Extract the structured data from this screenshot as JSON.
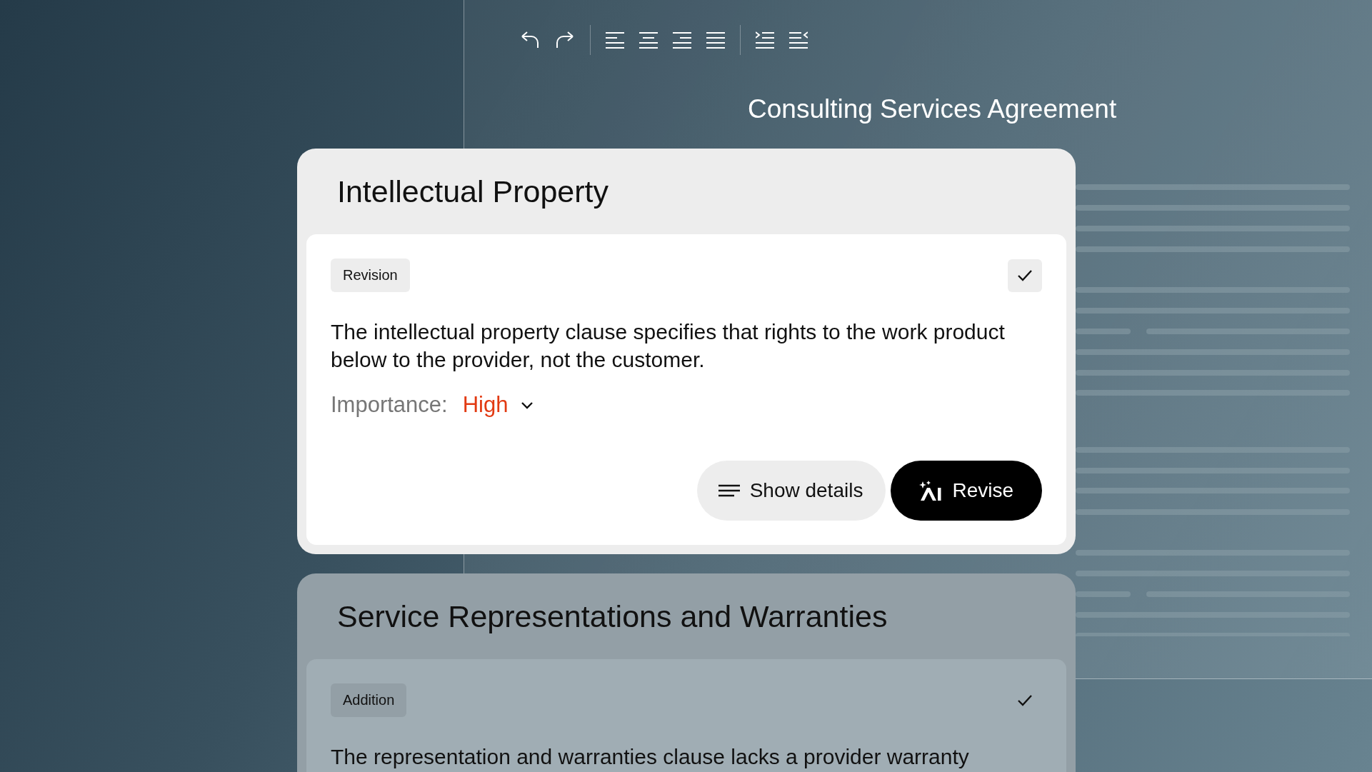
{
  "document": {
    "title": "Consulting Services Agreement"
  },
  "cards": [
    {
      "title": "Intellectual Property",
      "selected": true,
      "tag": "Revision",
      "text": "The intellectual property clause specifies that rights to the work product below to the provider, not the customer.",
      "importance": {
        "label": "Importance:",
        "value": "High"
      },
      "buttons": [
        {
          "label": "Show details",
          "kind": "secondary"
        },
        {
          "label": "Revise",
          "kind": "primary"
        }
      ]
    },
    {
      "title": "Service Representations and Warranties",
      "selected": false,
      "tag": "Addition",
      "text": "The representation and warranties clause lacks a provider warranty"
    }
  ]
}
